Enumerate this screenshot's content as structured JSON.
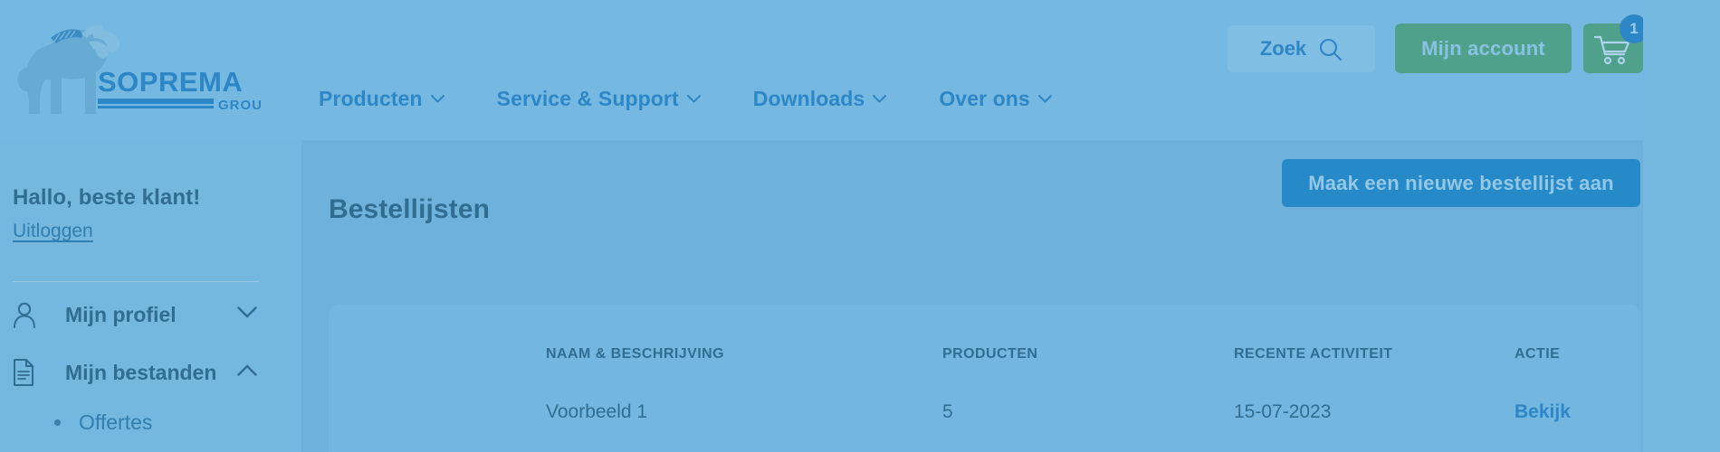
{
  "header": {
    "logo": {
      "brand": "SOPREMA",
      "sub": "GROUP",
      "icon": "mammoth-logo-icon"
    },
    "nav": [
      {
        "label": "Producten",
        "caret": "chevron-down-icon"
      },
      {
        "label": "Service & Support",
        "caret": "chevron-down-icon"
      },
      {
        "label": "Downloads",
        "caret": "chevron-down-icon"
      },
      {
        "label": "Over ons",
        "caret": "chevron-down-icon"
      }
    ],
    "search": {
      "label": "Zoek",
      "icon": "search-icon"
    },
    "account": {
      "label": "Mijn account"
    },
    "cart": {
      "icon": "shopping-cart-icon",
      "badge": "1"
    }
  },
  "sidebar": {
    "greeting": "Hallo, beste klant!",
    "logout": "Uitloggen",
    "items": [
      {
        "label": "Mijn profiel",
        "icon": "user-icon",
        "chevron": "chevron-down-icon",
        "expanded": false
      },
      {
        "label": "Mijn bestanden",
        "icon": "document-icon",
        "chevron": "chevron-up-icon",
        "expanded": true
      }
    ],
    "sub_items": [
      {
        "label": "Offertes"
      }
    ]
  },
  "main": {
    "title": "Bestellijsten",
    "create_button": "Maak een nieuwe bestellijst aan",
    "table": {
      "columns": [
        "NAAM & BESCHRIJVING",
        "PRODUCTEN",
        "RECENTE ACTIVITEIT",
        "ACTIE"
      ],
      "rows": [
        {
          "name": "Voorbeeld 1",
          "products": "5",
          "activity": "15-07-2023",
          "action": "Bekijk"
        }
      ]
    }
  },
  "colors": {
    "page_bg": "#7dbde3",
    "header_bg": "#7fbfe5",
    "main_bg": "#74b6de",
    "brand_blue": "#1878bd",
    "dark_text": "#1d5473",
    "green_button": "#4a9e6b",
    "primary_button": "#0f7dc2"
  }
}
